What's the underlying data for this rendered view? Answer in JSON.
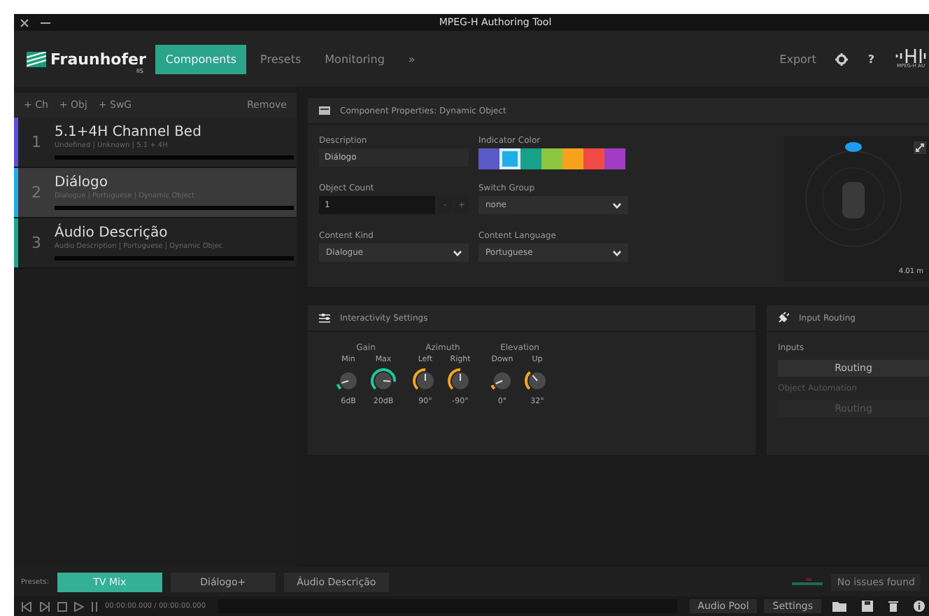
{
  "window": {
    "title": "MPEG-H Authoring Tool"
  },
  "header": {
    "logo": "Fraunhofer",
    "logo_sub": "IIS",
    "tabs": [
      {
        "label": "Components",
        "selected": true
      },
      {
        "label": "Presets",
        "selected": false
      },
      {
        "label": "Monitoring",
        "selected": false
      },
      {
        "label": "»",
        "selected": false
      }
    ],
    "export": "Export",
    "help": "?",
    "brand": "MPEG-H AU"
  },
  "components": {
    "add_buttons": [
      "+ Ch",
      "+ Obj",
      "+ SwG"
    ],
    "remove": "Remove",
    "items": [
      {
        "index": "1",
        "title": "5.1+4H Channel Bed",
        "subtitle": "Undefined | Unknown | 5.1 + 4H",
        "color": "#5b4fd6",
        "selected": false
      },
      {
        "index": "2",
        "title": "Diálogo",
        "subtitle": "Dialogue | Portuguese | Dynamic Object",
        "color": "#1eaee8",
        "selected": true
      },
      {
        "index": "3",
        "title": "Áudio Descrição",
        "subtitle": "Audio Description | Portuguese | Dynamic Objec",
        "color": "#21a58f",
        "selected": false
      }
    ]
  },
  "properties": {
    "title": "Component Properties: Dynamic Object",
    "description": {
      "label": "Description",
      "value": "Diálogo"
    },
    "indicator_color": {
      "label": "Indicator Color",
      "swatches": [
        {
          "color": "#5b58c8",
          "selected": false
        },
        {
          "color": "#1eaee8",
          "selected": true
        },
        {
          "color": "#17a08a",
          "selected": false
        },
        {
          "color": "#8cc63f",
          "selected": false
        },
        {
          "color": "#f7a21b",
          "selected": false
        },
        {
          "color": "#f04a45",
          "selected": false
        },
        {
          "color": "#a23cc4",
          "selected": false
        }
      ]
    },
    "object_count": {
      "label": "Object Count",
      "value": "1",
      "minus": "-",
      "plus": "+"
    },
    "switch_group": {
      "label": "Switch Group",
      "value": "none"
    },
    "content_kind": {
      "label": "Content Kind",
      "value": "Dialogue"
    },
    "content_language": {
      "label": "Content Language",
      "value": "Portuguese"
    },
    "scene": {
      "distance": "4.01 m"
    }
  },
  "interactivity": {
    "title": "Interactivity Settings",
    "groups": [
      {
        "label": "Gain",
        "color": "#19c9a0",
        "knobs": [
          {
            "label": "Min",
            "reading": "6dB"
          },
          {
            "label": "Max",
            "reading": "20dB"
          }
        ]
      },
      {
        "label": "Azimuth",
        "color": "#f5a623",
        "knobs": [
          {
            "label": "Left",
            "reading": "90°"
          },
          {
            "label": "Right",
            "reading": "-90°"
          }
        ]
      },
      {
        "label": "Elevation",
        "color": "#f5a623",
        "knobs": [
          {
            "label": "Down",
            "reading": "0°"
          },
          {
            "label": "Up",
            "reading": "32°"
          }
        ]
      }
    ]
  },
  "input_routing": {
    "title": "Input Routing",
    "inputs_label": "Inputs",
    "routing": {
      "label": "Routing",
      "disabled": false
    },
    "automation_label": "Object Automation",
    "automation_routing": {
      "label": "Routing",
      "disabled": true
    }
  },
  "presets": {
    "label": "Presets:",
    "items": [
      {
        "label": "TV Mix",
        "selected": true
      },
      {
        "label": "Diálogo+",
        "selected": false
      },
      {
        "label": "Áudio Descrição",
        "selected": false
      }
    ],
    "status": "No issues found"
  },
  "transport": {
    "time": "00:00:00.000 / 00:00:00.000",
    "buttons": [
      "Audio Pool",
      "Settings"
    ]
  }
}
